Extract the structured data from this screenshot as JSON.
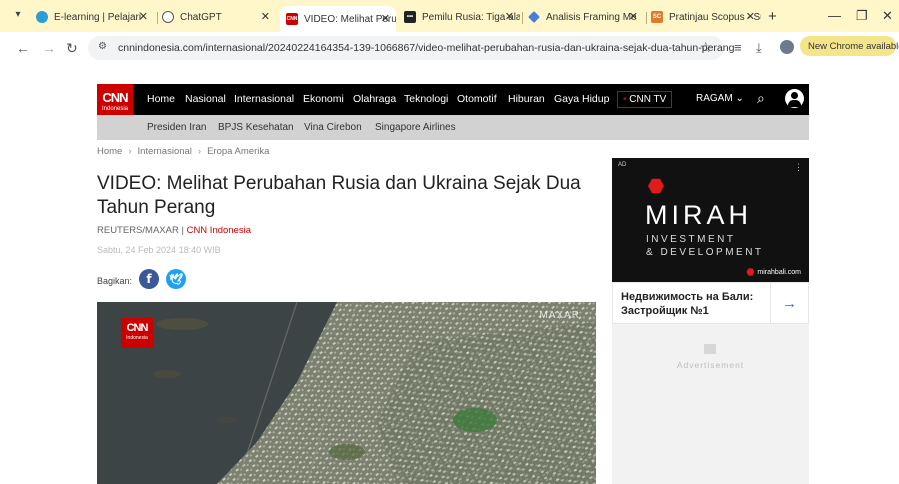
{
  "browser": {
    "tabs": [
      {
        "title": "E-learning | Pelajari",
        "favicon_color": "#2a9fd6"
      },
      {
        "title": "ChatGPT",
        "favicon_color": "#555555"
      },
      {
        "title": "VIDEO: Melihat Perub",
        "favicon_color": "#cc0000",
        "favicon_text": "CNN"
      },
      {
        "title": "Pemilu Rusia: Tiga ala",
        "favicon_color": "#222222",
        "favicon_text": "•••"
      },
      {
        "title": "Analisis Framing Me",
        "favicon_color": "#4a7fd6"
      },
      {
        "title": "Pratinjau Scopus - Su",
        "favicon_color": "#e07a2a",
        "favicon_text": "SC"
      }
    ],
    "url": "cnnindonesia.com/internasional/20240224164354-139-1066867/video-melihat-perubahan-rusia-dan-ukraina-sejak-dua-tahun-perang",
    "new_chrome_label": "New Chrome available",
    "window_controls": {
      "minimize": "—",
      "restore": "❐",
      "close": "✕"
    }
  },
  "site": {
    "logo_main": "CNN",
    "logo_sub": "Indonesia",
    "nav": [
      "Home",
      "Nasional",
      "Internasional",
      "Ekonomi",
      "Olahraga",
      "Teknologi",
      "Otomotif",
      "Hiburan",
      "Gaya Hidup"
    ],
    "cnn_tv": "CNN TV",
    "ragam": "RAGAM",
    "trending": [
      "Presiden Iran",
      "BPJS Kesehatan",
      "Vina Cirebon",
      "Singapore Airlines"
    ]
  },
  "article": {
    "breadcrumb": [
      "Home",
      "Internasional",
      "Eropa Amerika"
    ],
    "headline": "VIDEO: Melihat Perubahan Rusia dan Ukraina Sejak Dua Tahun Perang",
    "credit_source": "REUTERS/MAXAR | ",
    "credit_outlet": "CNN Indonesia",
    "dateline": "Sabtu, 24 Feb 2024 18:40 WIB",
    "share_label": "Bagikan:",
    "video_watermark": "MAXAR"
  },
  "ad": {
    "tag": "AD",
    "brand": "MIRAH",
    "line1": "INVESTMENT",
    "line2": "& DEVELOPMENT",
    "site": "mirahbali.com",
    "card_text": "Недвижимость на Бали: Застройщик №1",
    "placeholder_text": "Advertisement"
  }
}
